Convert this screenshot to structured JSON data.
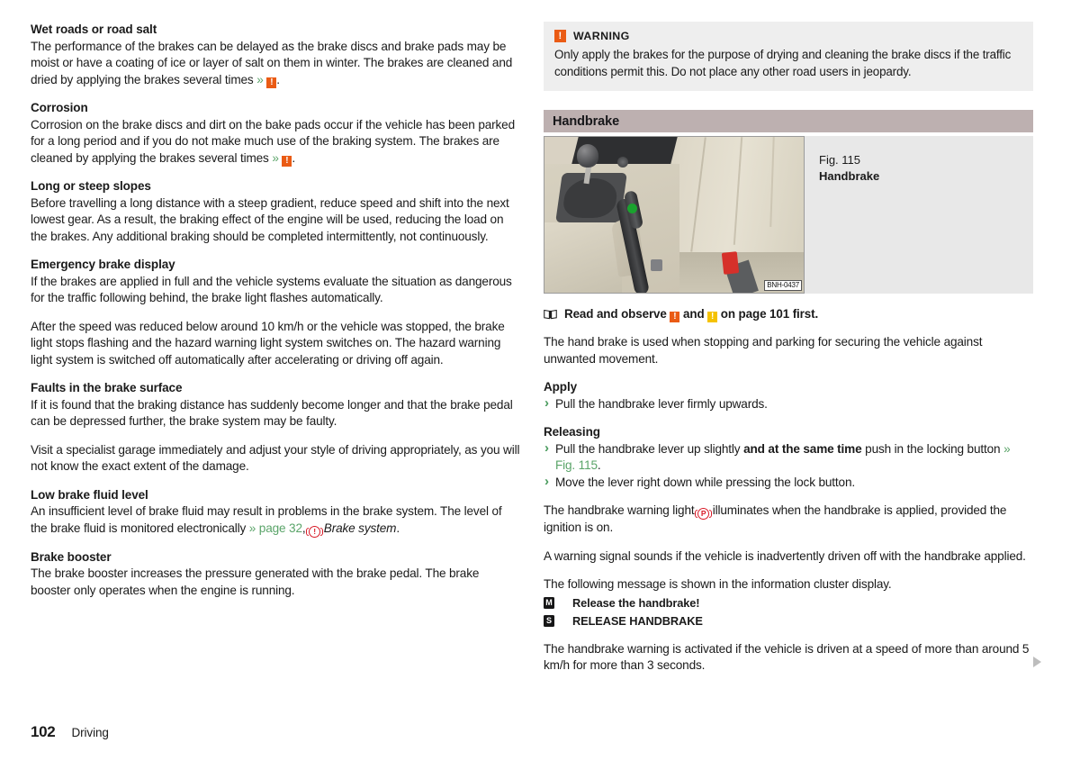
{
  "page": {
    "number": "102",
    "chapter": "Driving",
    "continuation_marker": "▶"
  },
  "colors": {
    "warning_orange": "#ea5b14",
    "note_yellow": "#f5c200",
    "reference_green": "#5aa469",
    "bullet_green": "#4a9b5e",
    "section_bar": "#bdb0b0",
    "warning_box_bg": "#eeeeee",
    "figure_bg": "#e8e8e8",
    "red_symbol": "#d81b28",
    "lock_button_green": "#1aa32e"
  },
  "left_column": [
    {
      "heading": "Wet roads or road salt",
      "paragraphs": [
        {
          "runs": [
            {
              "text": "The performance of the brakes can be delayed as the brake discs and brake pads may be moist or have a coating of ice or layer of salt on them in winter. The brakes are cleaned and dried by applying the brakes several times "
            },
            {
              "text": "»",
              "style": "chevron"
            },
            {
              "text": " "
            },
            {
              "icon": "warning-orange-icon"
            },
            {
              "text": "."
            }
          ]
        }
      ]
    },
    {
      "heading": "Corrosion",
      "paragraphs": [
        {
          "runs": [
            {
              "text": "Corrosion on the brake discs and dirt on the bake pads occur if the vehicle has been parked for a long period and if you do not make much use of the braking system. The brakes are cleaned by applying the brakes several times "
            },
            {
              "text": "»",
              "style": "chevron"
            },
            {
              "text": " "
            },
            {
              "icon": "warning-orange-icon"
            },
            {
              "text": "."
            }
          ]
        }
      ]
    },
    {
      "heading": "Long or steep slopes",
      "paragraphs": [
        {
          "runs": [
            {
              "text": "Before travelling a long distance with a steep gradient, reduce speed and shift into the next lowest gear. As a result, the braking effect of the engine will be used, reducing the load on the brakes. Any additional braking should be completed intermittently, not continuously."
            }
          ]
        }
      ]
    },
    {
      "heading": "Emergency brake display",
      "paragraphs": [
        {
          "runs": [
            {
              "text": "If the brakes are applied in full and the vehicle systems evaluate the situation as dangerous for the traffic following behind, the brake light flashes automatically."
            }
          ]
        },
        {
          "runs": [
            {
              "text": "After the speed was reduced below around 10 km/h or the vehicle was stopped, the brake light stops flashing and the hazard warning light system switches on. The hazard warning light system is switched off automatically after accelerating or driving off again."
            }
          ]
        }
      ]
    },
    {
      "heading": "Faults in the brake surface",
      "paragraphs": [
        {
          "runs": [
            {
              "text": "If it is found that the braking distance has suddenly become longer and that the brake pedal can be depressed further, the brake system may be faulty."
            }
          ]
        },
        {
          "runs": [
            {
              "text": "Visit a specialist garage immediately and adjust your style of driving appropriately, as you will not know the exact extent of the damage."
            }
          ]
        }
      ]
    },
    {
      "heading": "Low brake fluid level",
      "paragraphs": [
        {
          "runs": [
            {
              "text": "An insufficient level of brake fluid may result in problems in the brake system. The level of the brake fluid is monitored electronically "
            },
            {
              "text": "» page 32",
              "style": "reference"
            },
            {
              "text": ", "
            },
            {
              "icon": "brake-warning-symbol"
            },
            {
              "text": " "
            },
            {
              "text": "Brake system",
              "style": "italic"
            },
            {
              "text": "."
            }
          ]
        }
      ]
    },
    {
      "heading": "Brake booster",
      "paragraphs": [
        {
          "runs": [
            {
              "text": "The brake booster increases the pressure generated with the brake pedal. The brake booster only operates when the engine is running."
            }
          ]
        }
      ]
    }
  ],
  "right_column": {
    "warning_box": {
      "icon": "warning-orange-icon",
      "title": "WARNING",
      "text": "Only apply the brakes for the purpose of drying and cleaning the brake discs if the traffic conditions permit this. Do not place any other road users in jeopardy."
    },
    "section": {
      "title": "Handbrake"
    },
    "figure": {
      "caption_line1": "Fig. 115",
      "caption_line2": "Handbrake",
      "image_code": "BNH-0437",
      "image_alt": "Car interior showing the handbrake lever between the gear lever and the passenger seat, with a green-highlighted locking button"
    },
    "read_observe": {
      "icon": "book-icon",
      "prefix": "Read and observe",
      "icon_orange": "warning-orange-icon",
      "conjunction": "and",
      "icon_yellow": "note-yellow-icon",
      "suffix": "on page 101 first."
    },
    "intro_paragraph": "The hand brake is used when stopping and parking for securing the vehicle against unwanted movement.",
    "apply": {
      "heading": "Apply",
      "items": [
        {
          "runs": [
            {
              "text": "Pull the handbrake lever firmly upwards."
            }
          ]
        }
      ]
    },
    "releasing": {
      "heading": "Releasing",
      "items": [
        {
          "runs": [
            {
              "text": "Pull the handbrake lever up slightly "
            },
            {
              "text": "and at the same time",
              "style": "bold"
            },
            {
              "text": " push in the locking button "
            },
            {
              "text": "» Fig. 115",
              "style": "reference"
            },
            {
              "text": "."
            }
          ]
        },
        {
          "runs": [
            {
              "text": "Move the lever right down while pressing the lock button."
            }
          ]
        }
      ]
    },
    "paragraphs_after": [
      {
        "runs": [
          {
            "text": "The handbrake warning light "
          },
          {
            "icon": "handbrake-parking-symbol"
          },
          {
            "text": " illuminates when the handbrake is applied, provided the ignition is on."
          }
        ]
      },
      {
        "runs": [
          {
            "text": "A warning signal sounds if the vehicle is inadvertently driven off with the handbrake applied."
          }
        ]
      },
      {
        "runs": [
          {
            "text": "The following message is shown in the information cluster display."
          }
        ]
      }
    ],
    "cluster_messages": [
      {
        "badge": "M",
        "badge_icon": "maxidot-display-icon",
        "text": "Release the handbrake!"
      },
      {
        "badge": "S",
        "badge_icon": "segment-display-icon",
        "text": "RELEASE HANDBRAKE"
      }
    ],
    "closing_paragraph": "The handbrake warning is activated if the vehicle is driven at a speed of more than around 5 km/h for more than 3 seconds."
  }
}
